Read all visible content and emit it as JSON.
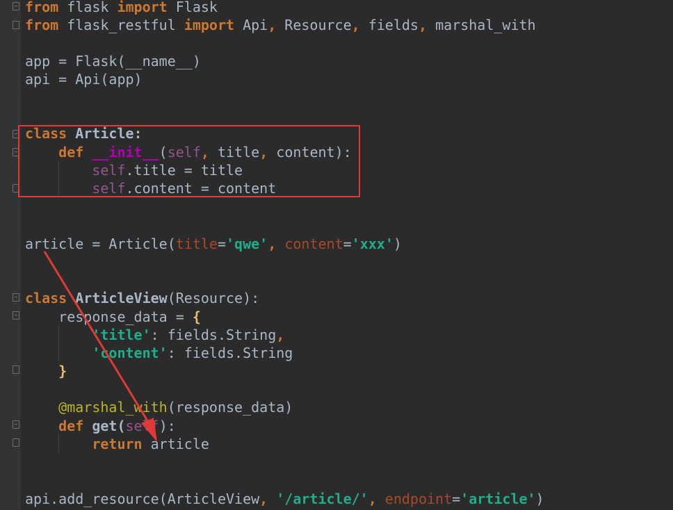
{
  "colors": {
    "background": "#2b2b2b",
    "keyword": "#cc7832",
    "plain": "#a9b7c6",
    "string": "#6a8759",
    "string_bold": "#1fae8c",
    "self": "#94558d",
    "param": "#aa4926",
    "dunder": "#b200b2",
    "decorator": "#bbb529",
    "brace": "#e8bf6a",
    "builtin": "#8888c6",
    "annotation_red": "#e03a36"
  },
  "code_lines": [
    {
      "id": "l1",
      "tokens": [
        {
          "t": "from",
          "c": "keyword"
        },
        {
          "t": " flask ",
          "c": "plain"
        },
        {
          "t": "import",
          "c": "keyword"
        },
        {
          "t": " Flask",
          "c": "plain"
        }
      ]
    },
    {
      "id": "l2",
      "tokens": [
        {
          "t": "from",
          "c": "keyword"
        },
        {
          "t": " flask_restful ",
          "c": "plain"
        },
        {
          "t": "import",
          "c": "keyword"
        },
        {
          "t": " Api",
          "c": "plain"
        },
        {
          "t": ",",
          "c": "keyword"
        },
        {
          "t": " Resource",
          "c": "plain"
        },
        {
          "t": ",",
          "c": "keyword"
        },
        {
          "t": " fields",
          "c": "plain"
        },
        {
          "t": ",",
          "c": "keyword"
        },
        {
          "t": " marshal_with",
          "c": "plain"
        }
      ]
    },
    {
      "id": "l3",
      "tokens": []
    },
    {
      "id": "l4",
      "tokens": [
        {
          "t": "app = Flask(__name__)",
          "c": "plain"
        }
      ]
    },
    {
      "id": "l5",
      "tokens": [
        {
          "t": "api = Api(app)",
          "c": "plain"
        }
      ]
    },
    {
      "id": "l6",
      "tokens": []
    },
    {
      "id": "l7",
      "tokens": []
    },
    {
      "id": "l8",
      "tokens": [
        {
          "t": "class",
          "c": "keyword"
        },
        {
          "t": " Article:",
          "c": "plainbold"
        }
      ]
    },
    {
      "id": "l9",
      "tokens": [
        {
          "t": "    def",
          "c": "keyword"
        },
        {
          "t": " ",
          "c": "plain"
        },
        {
          "t": "__init__",
          "c": "dunder"
        },
        {
          "t": "(",
          "c": "plain"
        },
        {
          "t": "self",
          "c": "self"
        },
        {
          "t": ",",
          "c": "keyword"
        },
        {
          "t": " title",
          "c": "plain"
        },
        {
          "t": ",",
          "c": "keyword"
        },
        {
          "t": " content):",
          "c": "plain"
        }
      ]
    },
    {
      "id": "l10",
      "tokens": [
        {
          "t": "        self",
          "c": "self"
        },
        {
          "t": ".title = title",
          "c": "plain"
        }
      ]
    },
    {
      "id": "l11",
      "tokens": [
        {
          "t": "        self",
          "c": "self"
        },
        {
          "t": ".content = content",
          "c": "plain"
        }
      ]
    },
    {
      "id": "l12",
      "tokens": []
    },
    {
      "id": "l13",
      "tokens": []
    },
    {
      "id": "l14",
      "tokens": [
        {
          "t": "article = Article(",
          "c": "plain"
        },
        {
          "t": "title",
          "c": "param"
        },
        {
          "t": "=",
          "c": "plain"
        },
        {
          "t": "'qwe'",
          "c": "string_bold"
        },
        {
          "t": ",",
          "c": "keyword"
        },
        {
          "t": " content",
          "c": "param"
        },
        {
          "t": "=",
          "c": "plain"
        },
        {
          "t": "'xxx'",
          "c": "string_bold"
        },
        {
          "t": ")",
          "c": "plain"
        }
      ]
    },
    {
      "id": "l15",
      "tokens": []
    },
    {
      "id": "l16",
      "tokens": []
    },
    {
      "id": "l17",
      "tokens": [
        {
          "t": "class",
          "c": "keyword"
        },
        {
          "t": " ArticleView",
          "c": "plainbold"
        },
        {
          "t": "(Resource):",
          "c": "plain"
        }
      ]
    },
    {
      "id": "l18",
      "tokens": [
        {
          "t": "    response_data = ",
          "c": "plain"
        },
        {
          "t": "{",
          "c": "brace"
        }
      ]
    },
    {
      "id": "l19",
      "tokens": [
        {
          "t": "        'title'",
          "c": "string_bold"
        },
        {
          "t": ": fields.String",
          "c": "plain"
        },
        {
          "t": ",",
          "c": "keyword"
        }
      ]
    },
    {
      "id": "l20",
      "tokens": [
        {
          "t": "        'content'",
          "c": "string_bold"
        },
        {
          "t": ": fields.String",
          "c": "plain"
        }
      ]
    },
    {
      "id": "l21",
      "tokens": [
        {
          "t": "    }",
          "c": "brace"
        }
      ]
    },
    {
      "id": "l22",
      "tokens": []
    },
    {
      "id": "l23",
      "tokens": [
        {
          "t": "    @marshal_with",
          "c": "decorator"
        },
        {
          "t": "(response_data)",
          "c": "plain"
        }
      ]
    },
    {
      "id": "l24",
      "tokens": [
        {
          "t": "    def",
          "c": "keyword"
        },
        {
          "t": " get(",
          "c": "plainbold"
        },
        {
          "t": "self",
          "c": "self"
        },
        {
          "t": "):",
          "c": "plain"
        }
      ]
    },
    {
      "id": "l25",
      "tokens": [
        {
          "t": "        return",
          "c": "keyword"
        },
        {
          "t": " article",
          "c": "plain"
        }
      ]
    },
    {
      "id": "l26",
      "tokens": []
    },
    {
      "id": "l27",
      "tokens": []
    },
    {
      "id": "l28",
      "tokens": [
        {
          "t": "api.add_resource(ArticleView",
          "c": "plain"
        },
        {
          "t": ",",
          "c": "keyword"
        },
        {
          "t": " ",
          "c": "plain"
        },
        {
          "t": "'/article/'",
          "c": "string_bold"
        },
        {
          "t": ",",
          "c": "keyword"
        },
        {
          "t": " endpoint",
          "c": "param"
        },
        {
          "t": "=",
          "c": "plain"
        },
        {
          "t": "'article'",
          "c": "string_bold"
        },
        {
          "t": ")",
          "c": "plain"
        }
      ]
    }
  ]
}
